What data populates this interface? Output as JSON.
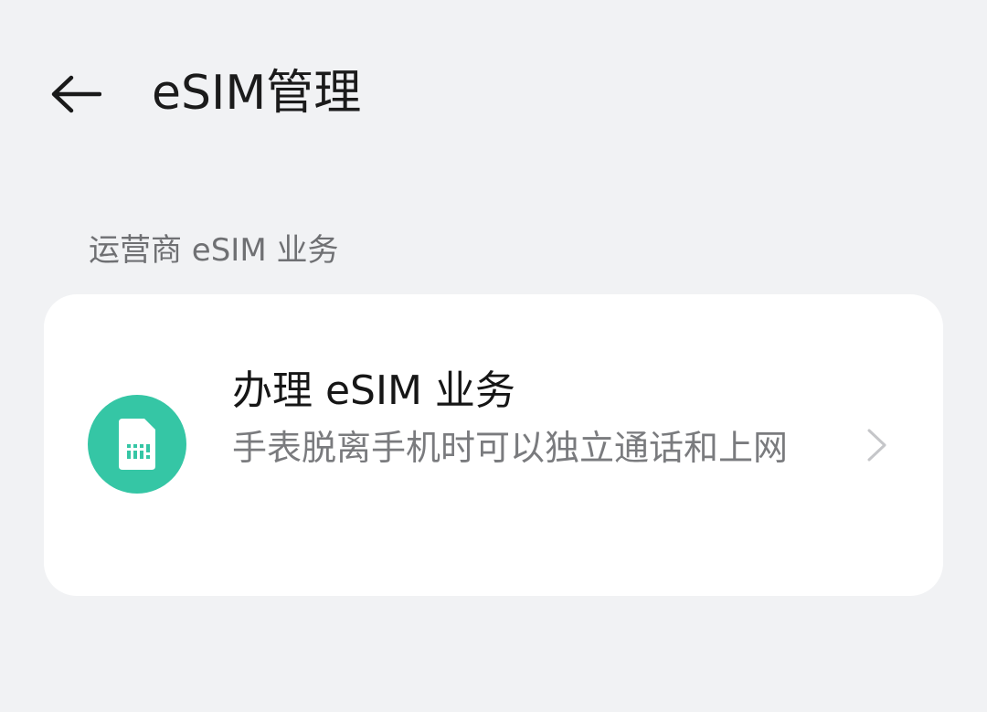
{
  "header": {
    "back_icon": "arrow-left-icon",
    "title": "eSIM管理"
  },
  "section": {
    "label": "运营商 eSIM 业务"
  },
  "item": {
    "icon": "sim-card-icon",
    "icon_color": "#35c6a5",
    "title": "办理 eSIM 业务",
    "description": "手表脱离手机时可以独立通话和上网",
    "chevron_icon": "chevron-right-icon"
  }
}
